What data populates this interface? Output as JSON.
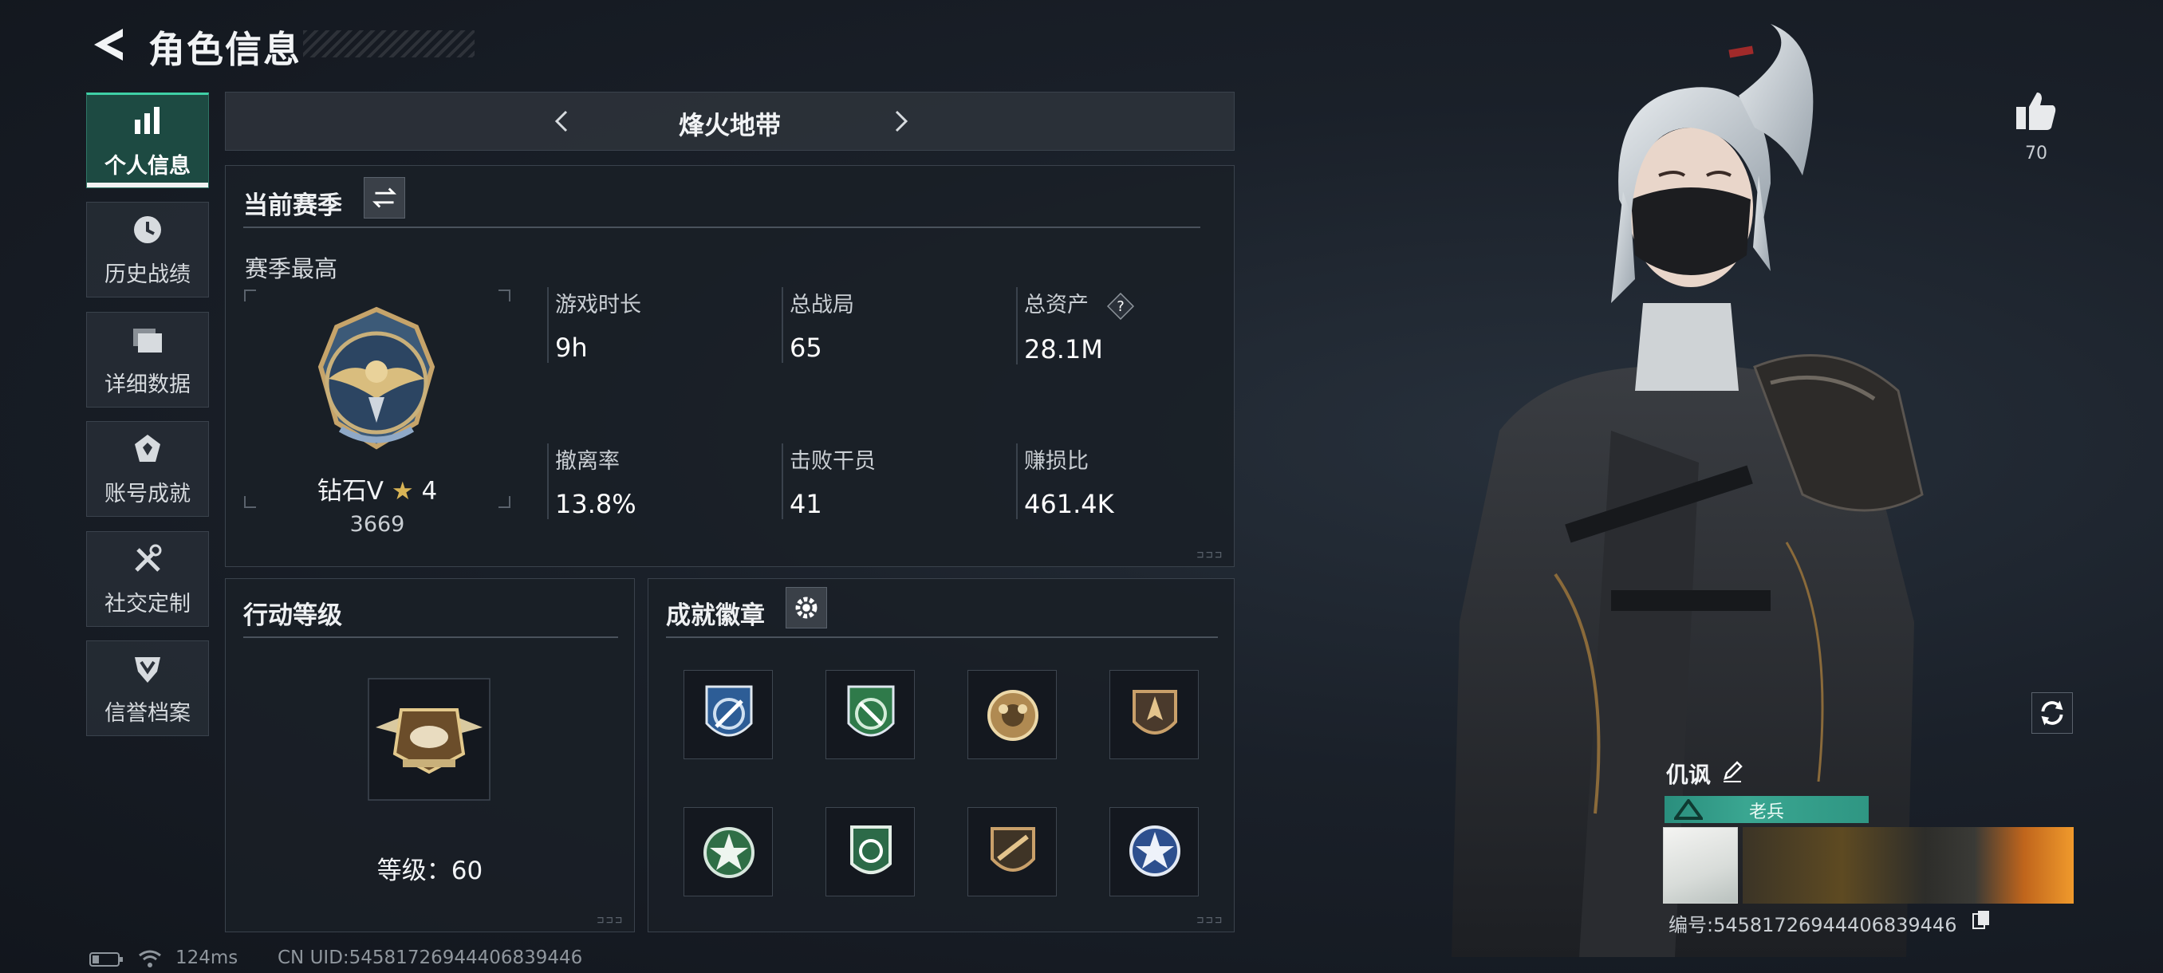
{
  "header": {
    "title": "角色信息"
  },
  "sidebar": {
    "items": [
      {
        "label": "个人信息",
        "icon": "bar-chart-icon",
        "active": true
      },
      {
        "label": "历史战绩",
        "icon": "clock-icon"
      },
      {
        "label": "详细数据",
        "icon": "folder-icon"
      },
      {
        "label": "账号成就",
        "icon": "achievement-icon"
      },
      {
        "label": "社交定制",
        "icon": "tools-icon"
      },
      {
        "label": "信誉档案",
        "icon": "credit-shield-icon"
      }
    ]
  },
  "mode": {
    "name": "烽火地带"
  },
  "season": {
    "title": "当前赛季",
    "subtitle": "赛季最高",
    "rank_name": "钻石V",
    "rank_stars": "4",
    "rank_points": "3669",
    "stats": [
      {
        "label": "游戏时长",
        "value": "9h"
      },
      {
        "label": "总战局",
        "value": "65"
      },
      {
        "label": "总资产",
        "value": "28.1M",
        "help": "?"
      },
      {
        "label": "撤离率",
        "value": "13.8%"
      },
      {
        "label": "击败干员",
        "value": "41"
      },
      {
        "label": "赚损比",
        "value": "461.4K"
      }
    ]
  },
  "action_level": {
    "title": "行动等级",
    "label": "等级：60"
  },
  "badges": {
    "title": "成就徽章",
    "items": [
      {
        "icon": "blue-shield-badge-icon"
      },
      {
        "icon": "green-shield-badge-icon"
      },
      {
        "icon": "bronze-round-badge-icon"
      },
      {
        "icon": "bronze-arrow-badge-icon"
      },
      {
        "icon": "green-star-badge-icon"
      },
      {
        "icon": "green-crest-badge-icon"
      },
      {
        "icon": "bronze-rifle-badge-icon"
      },
      {
        "icon": "blue-star-badge-icon"
      }
    ]
  },
  "profile": {
    "likes": "70",
    "name": "仉讽",
    "title": "老兵",
    "id_label": "编号:54581726944406839446"
  },
  "status_bar": {
    "ping": "124ms",
    "uid": "CN UID:54581726944406839446"
  },
  "colors": {
    "accent": "#3fd0a6",
    "title_bar": "#3aa691",
    "background": "#1a2029"
  }
}
